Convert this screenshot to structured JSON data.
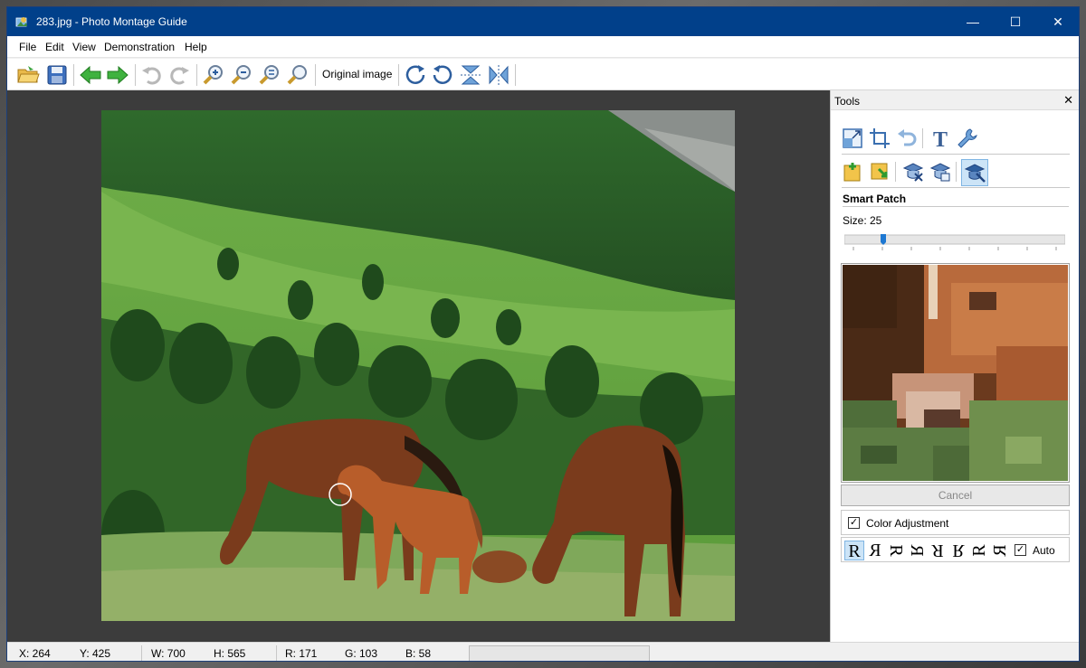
{
  "window": {
    "title": "283.jpg - Photo Montage Guide",
    "minimize": "—",
    "maximize": "☐",
    "close": "✕"
  },
  "menu": {
    "items": [
      "File",
      "Edit",
      "View",
      "Demonstration",
      "Help"
    ]
  },
  "toolbar": {
    "original_image_label": "Original image",
    "icons": [
      "open-folder-icon",
      "save-icon",
      "back-arrow-icon",
      "forward-arrow-icon",
      "undo-icon",
      "redo-icon",
      "zoom-in-icon",
      "zoom-out-icon",
      "zoom-fit-icon",
      "zoom-actual-icon",
      "rotate-right-icon",
      "rotate-left-icon",
      "flip-vertical-icon",
      "flip-horizontal-icon"
    ]
  },
  "tools_panel": {
    "title": "Tools",
    "close_label": "✕",
    "section_title": "Smart Patch",
    "size_label": "Size: 25",
    "size_value": 25,
    "cancel_label": "Cancel",
    "color_adjustment_label": "Color Adjustment",
    "color_adjustment_checked": true,
    "rotations": [
      "R",
      "R",
      "R",
      "R",
      "R",
      "R",
      "R",
      "R"
    ],
    "auto_label": "Auto",
    "auto_checked": true
  },
  "status": {
    "x": "X: 264",
    "y": "Y: 425",
    "w": "W: 700",
    "h": "H: 565",
    "r": "R: 171",
    "g": "G: 103",
    "b": "B: 58"
  },
  "colors": {
    "titlebar": "#01408a",
    "canvas_bg": "#3c3c3c",
    "accent": "#1e78d2"
  }
}
